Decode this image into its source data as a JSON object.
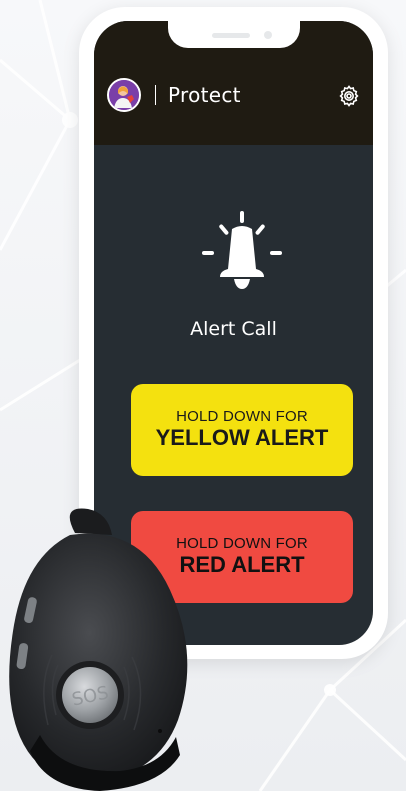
{
  "app": {
    "title": "Protect",
    "alert_label": "Alert Call"
  },
  "buttons": {
    "yellow": {
      "line1": "HOLD DOWN FOR",
      "line2": "YELLOW ALERT",
      "color": "#f4e10f"
    },
    "red": {
      "line1": "HOLD DOWN FOR",
      "line2": "RED ALERT",
      "color": "#f04a41"
    }
  },
  "device": {
    "button_text": "SOS"
  },
  "colors": {
    "screen_bg": "#262d33",
    "header_bg": "#1f1b12",
    "accent_avatar": "#7a3fa8"
  },
  "icons": {
    "settings": "gear-icon",
    "alert": "bell-icon",
    "avatar": "user-avatar"
  }
}
